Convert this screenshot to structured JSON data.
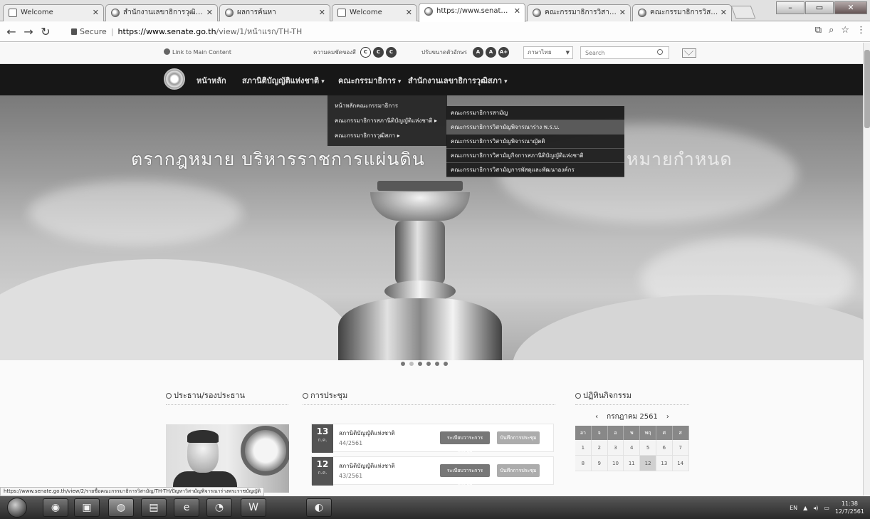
{
  "browser": {
    "tabs": [
      {
        "label": "Welcome",
        "active": false
      },
      {
        "label": "สำนักงานเลขาธิการวุฒิสภา",
        "active": false
      },
      {
        "label": "ผลการค้นหา",
        "active": false
      },
      {
        "label": "Welcome",
        "active": false
      },
      {
        "label": "https://www.senate.g",
        "active": true
      },
      {
        "label": "คณะกรรมาธิการวิสามัญ",
        "active": false
      },
      {
        "label": "คณะกรรมาธิการวิสามัญ",
        "active": false
      }
    ],
    "secure_label": "Secure",
    "url_host": "https://www.senate.go.th",
    "url_path": "/view/1/หน้าแรก/TH-TH"
  },
  "utility": {
    "skip_link": "Link to Main Content",
    "contrast_label": "ความคมชัดของสี",
    "contrast_buttons": [
      "C",
      "C",
      "C"
    ],
    "font_label": "ปรับขนาดตัวอักษร",
    "font_buttons": [
      "A",
      "A",
      "A+"
    ],
    "language": "ภาษาไทย",
    "search_placeholder": "Search"
  },
  "nav": {
    "items": [
      {
        "label": "หน้าหลัก"
      },
      {
        "label": "สภานิติบัญญัติแห่งชาติ"
      },
      {
        "label": "คณะกรรมาธิการ"
      },
      {
        "label": "สำนักงานเลขาธิการวุฒิสภา"
      }
    ]
  },
  "submenu": {
    "items": [
      "หน้าหลักคณะกรรมาธิการ",
      "คณะกรรมาธิการสภานิติบัญญัติแห่งชาติ",
      "คณะกรรมาธิการวุฒิสภา"
    ]
  },
  "flyout": {
    "items": [
      "คณะกรรมาธิการสามัญ",
      "คณะกรรมาธิการวิสามัญพิจารณาร่าง พ.ร.บ.",
      "คณะกรรมาธิการวิสามัญพิจารณาญัตติ",
      "คณะกรรมาธิการวิสามัญกิจการสภานิติบัญญัติแห่งชาติ",
      "คณะกรรมาธิการวิสามัญการพัสดุและพัฒนาองค์กร"
    ],
    "highlighted_index": 1
  },
  "hero": {
    "title": "ตรากฎหมาย บริหารราชการแผ่นดิน",
    "title_tail": "หมายกำหนด",
    "slides": 6,
    "active_slide": 1
  },
  "sections": {
    "president": {
      "heading": "ประธาน/รองประธาน"
    },
    "meetings": {
      "heading": "การประชุม",
      "items": [
        {
          "day": "13",
          "month": "ก.ค.",
          "title": "สภานิติบัญญัติแห่งชาติ",
          "number": "44/2561",
          "btn1": "ระเบียบวาระการประชุม",
          "btn2": "บันทึกการประชุม"
        },
        {
          "day": "12",
          "month": "ก.ค.",
          "title": "สภานิติบัญญัติแห่งชาติ",
          "number": "43/2561",
          "btn1": "ระเบียบวาระการประชุม",
          "btn2": "บันทึกการประชุม"
        }
      ]
    },
    "calendar": {
      "heading": "ปฏิทินกิจกรรม",
      "month_label": "กรกฎาคม 2561",
      "weekdays": [
        "อา",
        "จ",
        "อ",
        "พ",
        "พฤ",
        "ศ",
        "ส"
      ],
      "rows": [
        [
          "1",
          "2",
          "3",
          "4",
          "5",
          "6",
          "7"
        ],
        [
          "8",
          "9",
          "10",
          "11",
          "12",
          "13",
          "14"
        ]
      ],
      "today": "12"
    }
  },
  "status_bar": {
    "url": "https://www.senate.go.th/view/2/รายชื่อคณะกรรมาธิการวิสามัญ/TH-TH/ปัญหาวิสามัญพิจารณาร่างพระราชบัญญัติ"
  },
  "taskbar": {
    "lang": "EN",
    "time": "11:38",
    "date": "12/7/2561"
  }
}
